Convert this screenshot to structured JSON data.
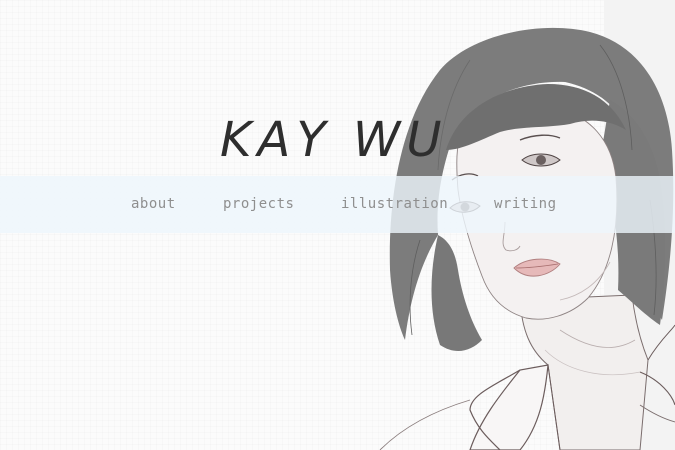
{
  "site": {
    "title": "KAY WU"
  },
  "nav": {
    "items": [
      {
        "label": "about"
      },
      {
        "label": "projects"
      },
      {
        "label": "illustration"
      },
      {
        "label": "writing"
      }
    ]
  },
  "hero": {
    "image": "pencil-sketch-portrait-of-woman-with-bob-haircut"
  },
  "colors": {
    "background": "#fbfbfb",
    "nav_band": "#eef6fc",
    "nav_text": "#8f8f8f",
    "title_text": "#2e2e2e",
    "hair": "#7e7e7e"
  }
}
